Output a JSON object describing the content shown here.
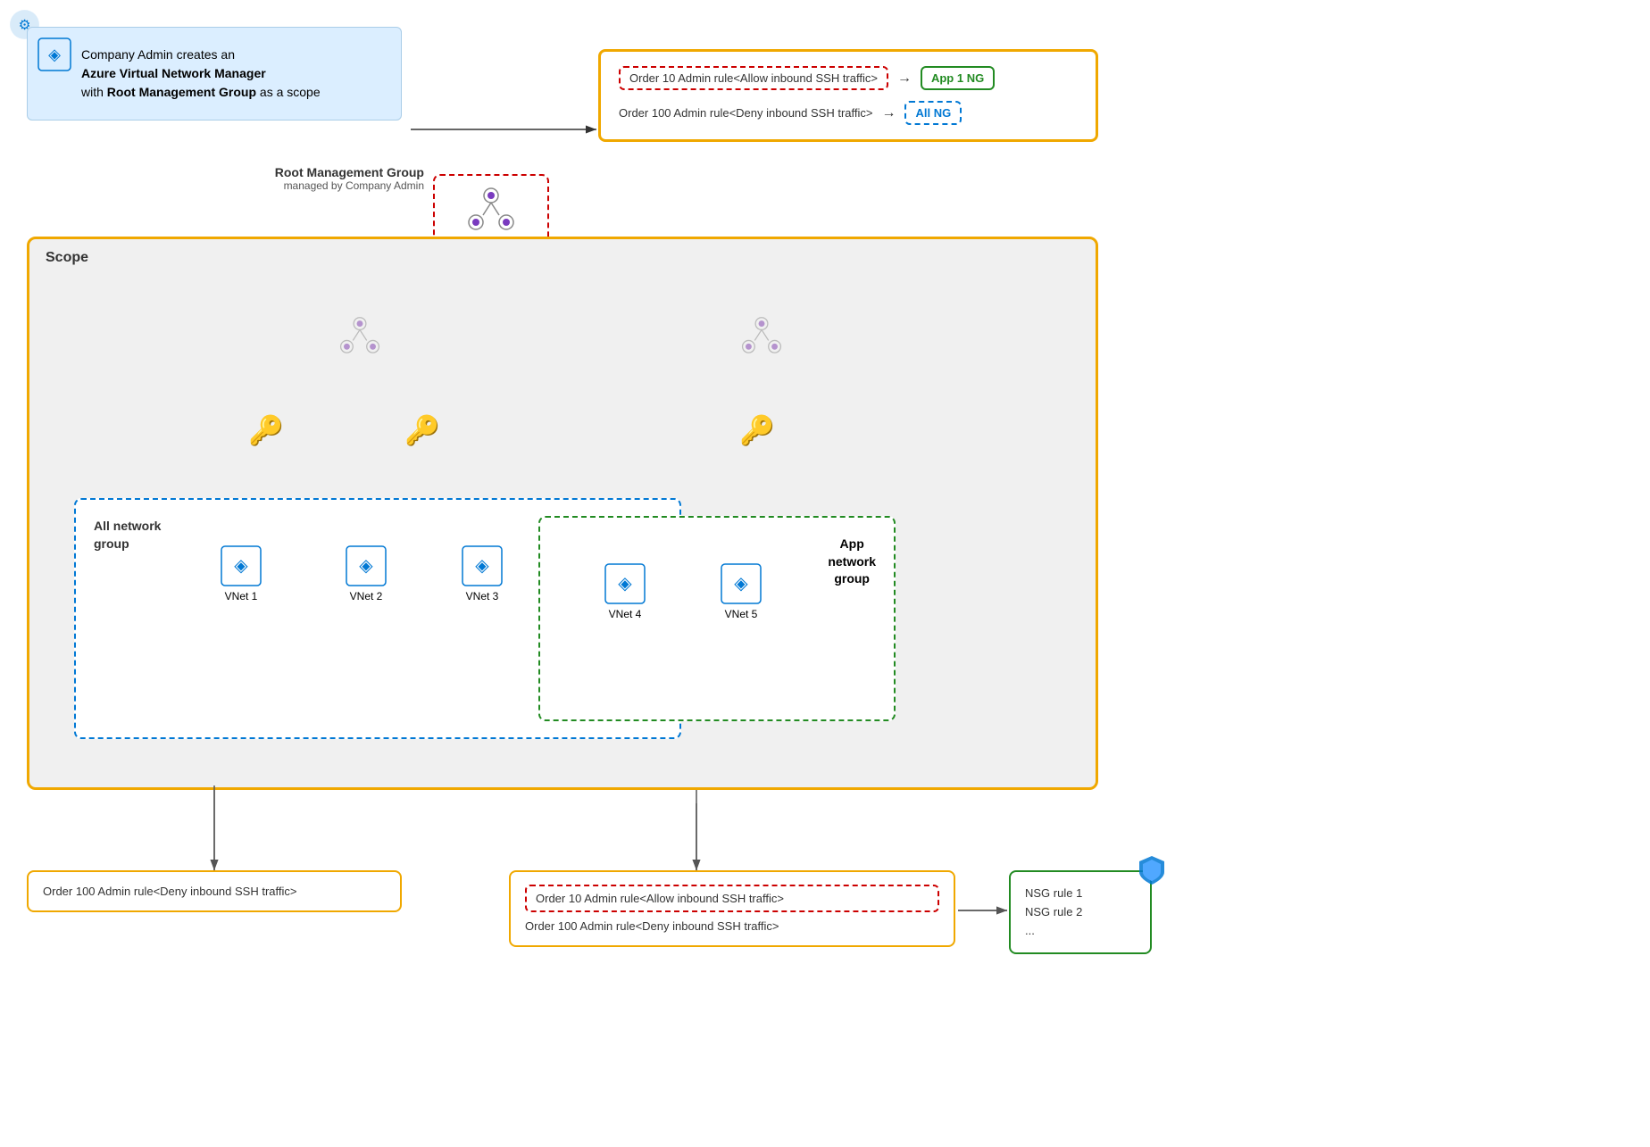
{
  "company_admin": {
    "line1": "Company Admin creates an",
    "bold1": "Azure Virtual Network Manager",
    "line2": "with",
    "bold2": "Root Management Group",
    "line3": "as a scope"
  },
  "top_rules": {
    "rule1_text": "Order 10 Admin rule<Allow inbound SSH traffic>",
    "rule1_arrow": "→",
    "rule1_badge": "App 1 NG",
    "rule2_text": "Order 100 Admin rule<Deny inbound SSH traffic>",
    "rule2_arrow": "→",
    "rule2_badge": "All NG"
  },
  "scope": {
    "label": "Scope"
  },
  "root_mg": {
    "label": "Root Management Group",
    "sublabel": "managed by Company Admin"
  },
  "groups": {
    "all_ng": "All network group",
    "app_ng": "App network group"
  },
  "vnets": [
    "VNet 1",
    "VNet 2",
    "VNet 3",
    "VNet 4",
    "VNet 5"
  ],
  "bottom_left_rule": "Order 100 Admin rule<Deny inbound SSH traffic>",
  "bottom_right": {
    "rule1": "Order 10 Admin rule<Allow inbound SSH traffic>",
    "rule2": "Order 100 Admin rule<Deny inbound SSH traffic>"
  },
  "nsg": {
    "rule1": "NSG rule 1",
    "rule2": "NSG rule 2",
    "more": "..."
  }
}
